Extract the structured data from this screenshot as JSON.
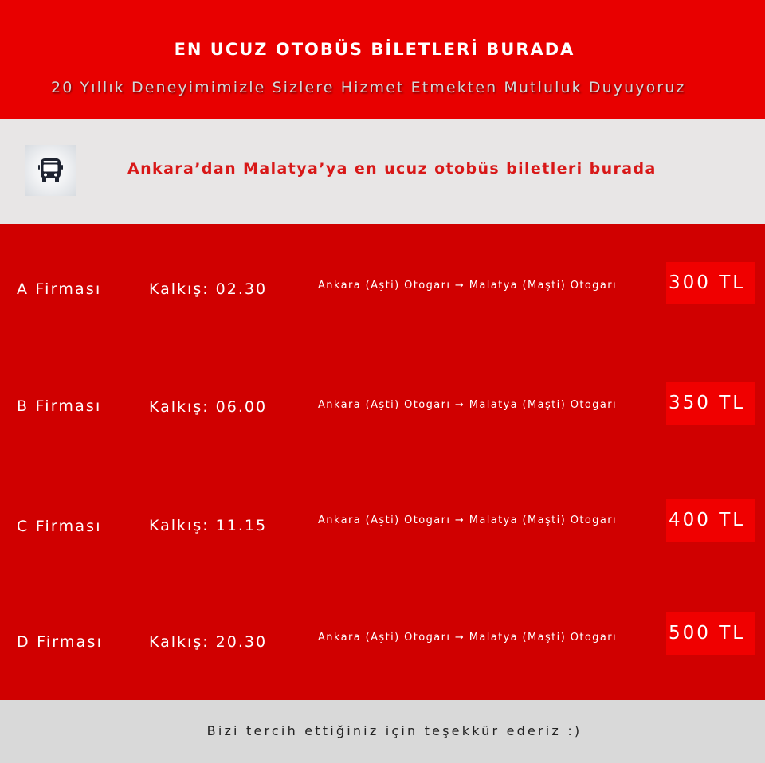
{
  "header": {
    "title": "EN UCUZ OTOBÜS BİLETLERİ BURADA",
    "subtitle": "20 Yıllık Deneyimimizle Sizlere Hizmet Etmekten Mutluluk Duyuyoruz"
  },
  "banner": {
    "icon": "bus-icon",
    "heading": "Ankara’dan Malatya’ya en ucuz otobüs biletleri burada"
  },
  "trips": [
    {
      "company": "A Firması",
      "departure": "Kalkış: 02.30",
      "route": "Ankara (Aşti) Otogarı → Malatya (Maşti) Otogarı",
      "price": "300 TL"
    },
    {
      "company": "B Firması",
      "departure": "Kalkış: 06.00",
      "route": "Ankara (Aşti) Otogarı → Malatya (Maşti) Otogarı",
      "price": "350 TL"
    },
    {
      "company": "C Firması",
      "departure": "Kalkış: 11.15",
      "route": "Ankara (Aşti) Otogarı → Malatya (Maşti) Otogarı",
      "price": "400 TL"
    },
    {
      "company": "D Firması",
      "departure": "Kalkış: 20.30",
      "route": "Ankara (Aşti) Otogarı → Malatya (Maşti) Otogarı",
      "price": "500 TL"
    }
  ],
  "footer": {
    "thanks": "Bizi tercih ettiğiniz için teşekkür ederiz :)"
  },
  "colors": {
    "header_bg": "#e80000",
    "list_bg": "#d00000",
    "price_bg": "#f00000",
    "banner_bg": "#e8e6e6",
    "banner_text": "#d81818",
    "footer_bg": "#d9d9d9"
  }
}
